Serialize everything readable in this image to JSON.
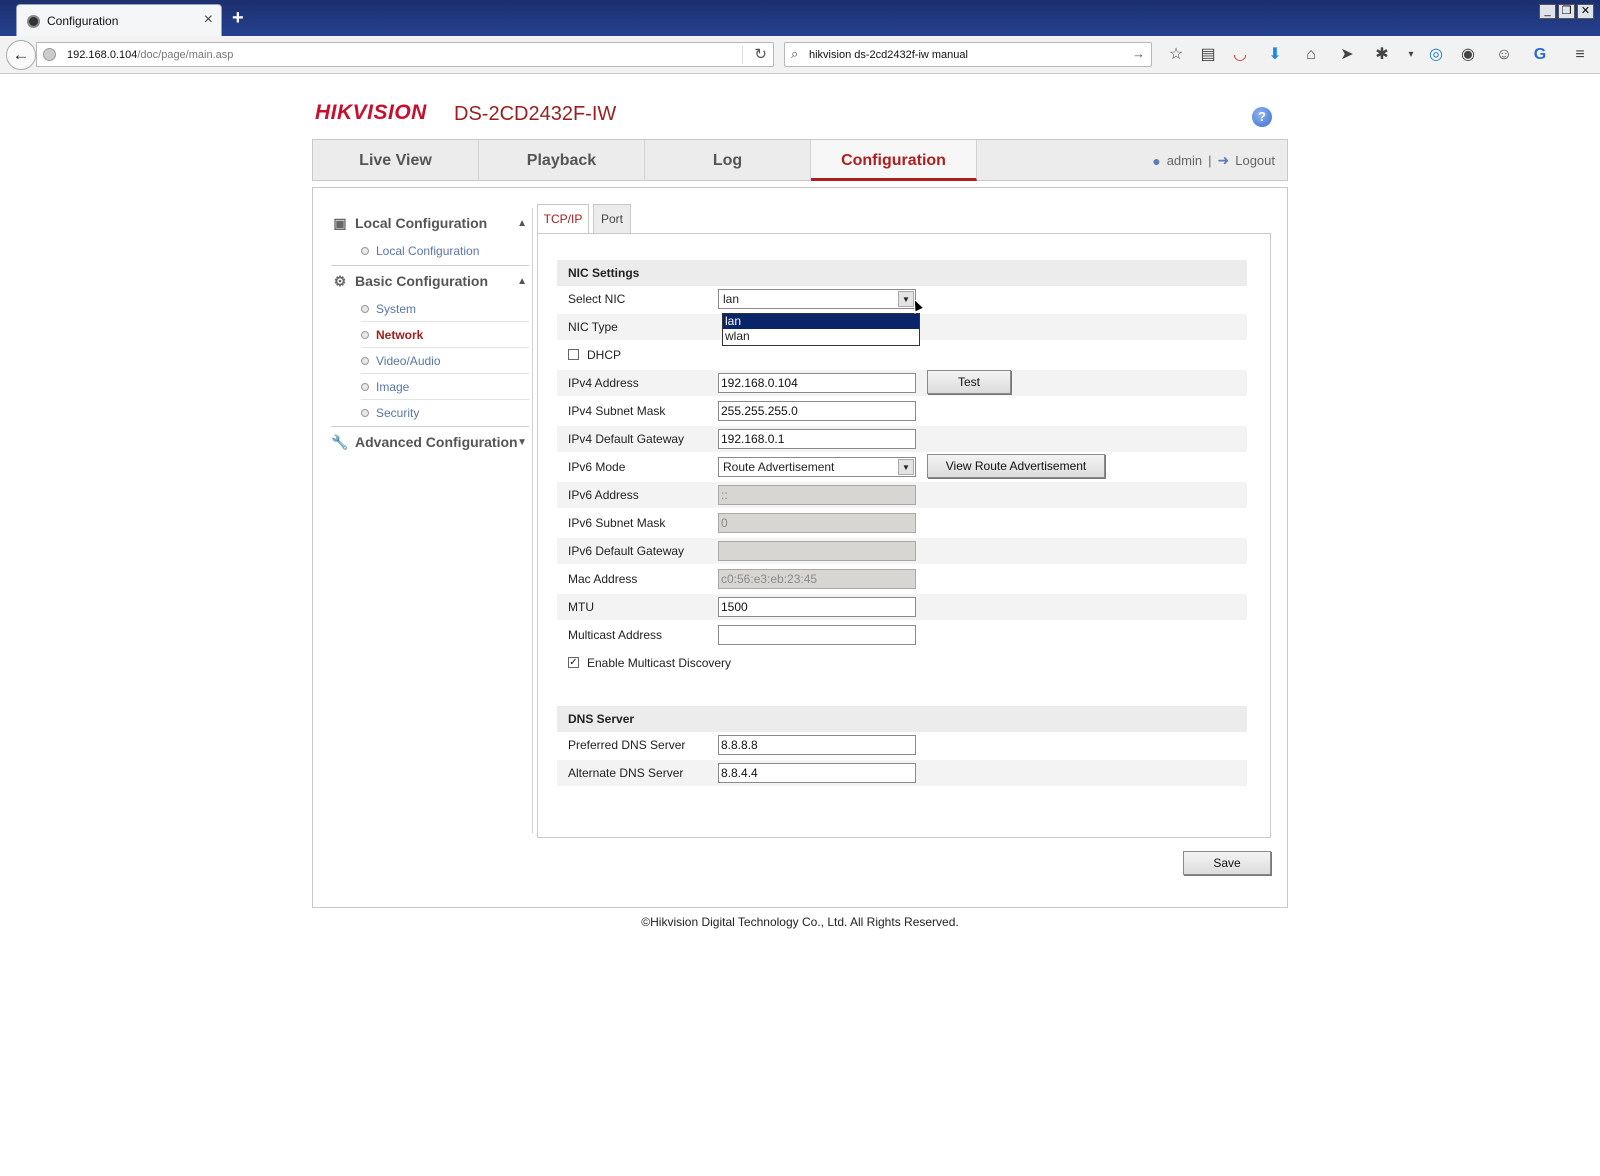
{
  "browser": {
    "tab_title": "Configuration",
    "new_tab": "+",
    "url_host": "192.168.0.104",
    "url_path": "/doc/page/main.asp",
    "search_text": "hikvision ds-2cd2432f-iw manual",
    "toolbar_icons": [
      "bookmark-star-icon",
      "reading-list-icon",
      "pocket-icon",
      "download-icon",
      "home-icon",
      "send-icon",
      "extension-icon",
      "dropdown-icon",
      "sync-icon",
      "history-icon",
      "chat-icon",
      "translate-icon",
      "menu-icon"
    ]
  },
  "header": {
    "brand": "HIKVISION",
    "model": "DS-2CD2432F-IW",
    "help": "?"
  },
  "topnav": {
    "items": [
      "Live View",
      "Playback",
      "Log",
      "Configuration"
    ],
    "active": "Configuration",
    "user": "admin",
    "separator": "|",
    "logout": "Logout"
  },
  "sidebar": {
    "local_config": "Local Configuration",
    "local_items": [
      "Local Configuration"
    ],
    "basic_config": "Basic Configuration",
    "basic_items": [
      "System",
      "Network",
      "Video/Audio",
      "Image",
      "Security"
    ],
    "active_item": "Network",
    "advanced_config": "Advanced Configuration"
  },
  "tabs": {
    "items": [
      "TCP/IP",
      "Port"
    ],
    "active": "TCP/IP"
  },
  "nic": {
    "section_title": "NIC Settings",
    "select_nic_label": "Select NIC",
    "select_nic_value": "lan",
    "select_nic_options": [
      "lan",
      "wlan"
    ],
    "nic_type_label": "NIC Type",
    "dhcp_label": "DHCP",
    "dhcp_checked": false,
    "ipv4_address_label": "IPv4 Address",
    "ipv4_address": "192.168.0.104",
    "test_button": "Test",
    "ipv4_mask_label": "IPv4 Subnet Mask",
    "ipv4_mask": "255.255.255.0",
    "ipv4_gateway_label": "IPv4 Default Gateway",
    "ipv4_gateway": "192.168.0.1",
    "ipv6_mode_label": "IPv6 Mode",
    "ipv6_mode": "Route Advertisement",
    "view_route_button": "View Route Advertisement",
    "ipv6_address_label": "IPv6 Address",
    "ipv6_address": "::",
    "ipv6_mask_label": "IPv6 Subnet Mask",
    "ipv6_mask": "0",
    "ipv6_gateway_label": "IPv6 Default Gateway",
    "ipv6_gateway": "",
    "mac_label": "Mac Address",
    "mac": "c0:56:e3:eb:23:45",
    "mtu_label": "MTU",
    "mtu": "1500",
    "multicast_label": "Multicast Address",
    "multicast": "",
    "multicast_discovery_label": "Enable Multicast Discovery",
    "multicast_discovery_checked": true
  },
  "dns": {
    "section_title": "DNS Server",
    "preferred_label": "Preferred DNS Server",
    "preferred": "8.8.8.8",
    "alternate_label": "Alternate DNS Server",
    "alternate": "8.8.4.4"
  },
  "save_button": "Save",
  "footer": "©Hikvision Digital Technology Co., Ltd. All Rights Reserved.",
  "colors": {
    "brand_red": "#c8102e",
    "active_red": "#b01f1f",
    "link_blue": "#5a76a8",
    "selected_option": "#0a246a"
  }
}
